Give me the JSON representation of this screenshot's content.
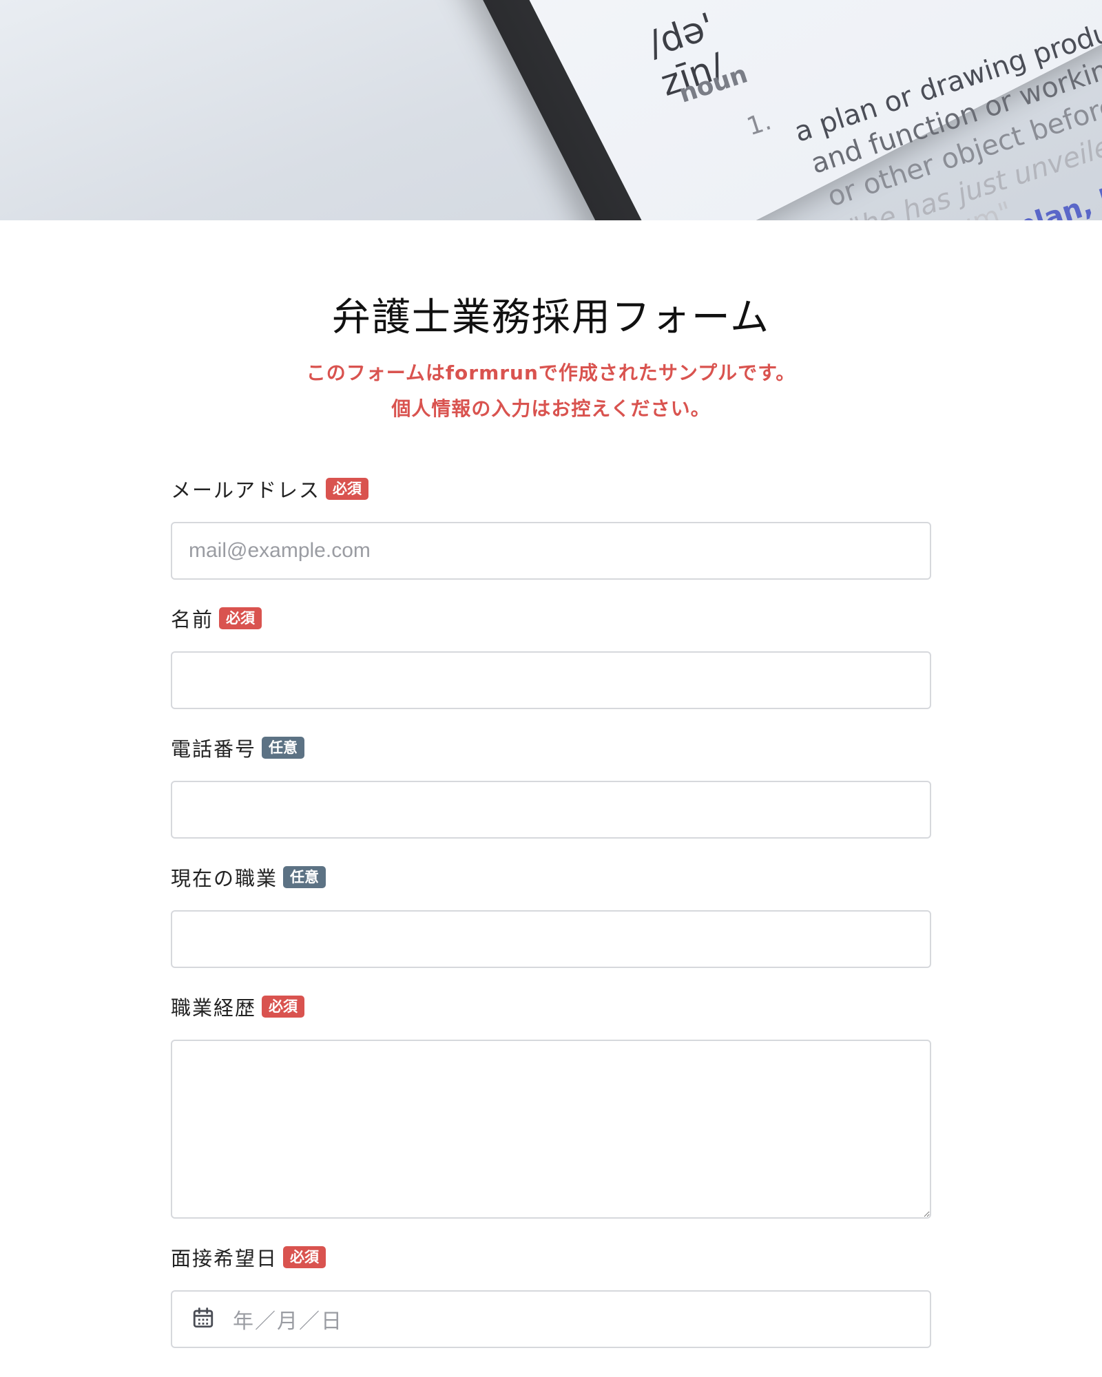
{
  "hero": {
    "phonetic": "/də' zīn/",
    "pos": "noun",
    "sense_number": "1.",
    "lines": [
      "a plan or drawing produce",
      "and function or working",
      "or other object before i",
      "\"he has just unveiled",
      "museum\"",
      "plan, bl"
    ]
  },
  "form": {
    "title": "弁護士業務採用フォーム",
    "notice_line1": "このフォームはformrunで作成されたサンプルです。",
    "notice_line2": "個人情報の入力はお控えください。",
    "badges": {
      "required": "必須",
      "optional": "任意"
    },
    "fields": {
      "email": {
        "label": "メールアドレス",
        "placeholder": "mail@example.com",
        "value": ""
      },
      "name": {
        "label": "名前",
        "placeholder": "",
        "value": ""
      },
      "phone": {
        "label": "電話番号",
        "placeholder": "",
        "value": ""
      },
      "occupation": {
        "label": "現在の職業",
        "placeholder": "",
        "value": ""
      },
      "career": {
        "label": "職業経歴",
        "placeholder": "",
        "value": ""
      },
      "interview_date": {
        "label": "面接希望日",
        "placeholder": "年／月／日",
        "icon": "calendar-icon"
      }
    }
  },
  "colors": {
    "required_badge": "#d9534f",
    "optional_badge": "#5c7284",
    "notice_text": "#d9534f",
    "input_border": "#d6d8dc"
  }
}
